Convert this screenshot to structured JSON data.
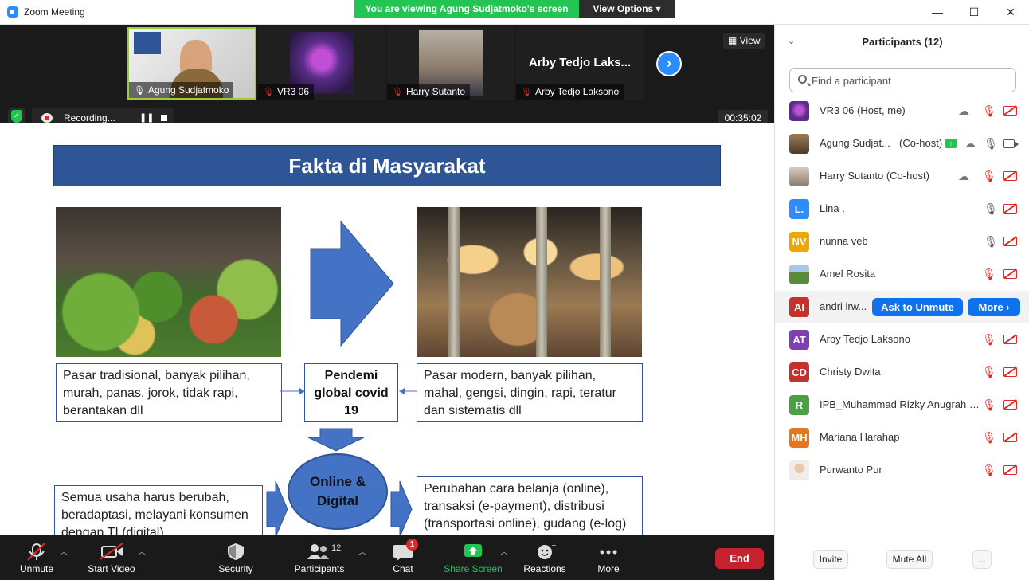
{
  "window": {
    "title": "Zoom Meeting",
    "viewing_banner": "You are viewing Agung Sudjatmoko's screen",
    "view_options": "View Options"
  },
  "strip": {
    "view_label": "View",
    "tiles": [
      {
        "name": "Agung Sudjatmoko"
      },
      {
        "name": "VR3 06"
      },
      {
        "name": "Harry Sutanto"
      },
      {
        "name": "Arby Tedjo Laksono",
        "big_text": "Arby Tedjo Laks..."
      }
    ],
    "recording_label": "Recording...",
    "timer": "00:35:02"
  },
  "slide": {
    "title": "Fakta di Masyarakat",
    "box_left": "Pasar tradisional, banyak pilihan, murah, panas, jorok, tidak rapi, berantakan dll",
    "box_center": "Pendemi global covid 19",
    "box_right": "Pasar modern, banyak pilihan, mahal, gengsi, dingin, rapi, teratur dan sistematis dll",
    "box_bottom_left": "Semua usaha harus berubah, beradaptasi, melayani konsumen dengan TI (digital)",
    "ellipse": "Online & Digital",
    "box_bottom_right": "Perubahan cara belanja (online), transaksi (e-payment), distribusi (transportasi online), gudang (e-log) dll"
  },
  "toolbar": {
    "unmute": "Unmute",
    "start_video": "Start Video",
    "security": "Security",
    "participants": "Participants",
    "participants_count": "12",
    "chat": "Chat",
    "chat_badge": "1",
    "share_screen": "Share Screen",
    "reactions": "Reactions",
    "more": "More",
    "end": "End"
  },
  "panel": {
    "title": "Participants (12)",
    "search_placeholder": "Find a participant",
    "participants": [
      {
        "initials": "",
        "name": "VR3 06 (Host, me)",
        "avatar_color": "#5b2d8a"
      },
      {
        "initials": "",
        "name": "Agung Sudjat...",
        "role": "(Co-host)",
        "avatar_color": "#6b5a44"
      },
      {
        "initials": "",
        "name": "Harry Sutanto (Co-host)",
        "avatar_color": "#9a8a78"
      },
      {
        "initials": "L.",
        "name": "Lina .",
        "avatar_color": "#2d8cff"
      },
      {
        "initials": "NV",
        "name": "nunna veb",
        "avatar_color": "#f0a500"
      },
      {
        "initials": "",
        "name": "Amel Rosita",
        "avatar_color": "#5d8a3a"
      },
      {
        "initials": "AI",
        "name": "andri irw...",
        "avatar_color": "#c4322e"
      },
      {
        "initials": "AT",
        "name": "Arby Tedjo Laksono",
        "avatar_color": "#7e3fb5"
      },
      {
        "initials": "CD",
        "name": "Christy Dwita",
        "avatar_color": "#c4322e"
      },
      {
        "initials": "R",
        "name": "IPB_Muhammad Rizky Anugrah Pr...",
        "avatar_color": "#4aa043"
      },
      {
        "initials": "MH",
        "name": "Mariana Harahap",
        "avatar_color": "#e2771d"
      },
      {
        "initials": "",
        "name": "Purwanto Pur",
        "avatar_color": "#d8c8b8"
      }
    ],
    "ask_to_unmute": "Ask to Unmute",
    "more_button": "More ›",
    "invite": "Invite",
    "mute_all": "Mute All",
    "ellipsis": "..."
  }
}
